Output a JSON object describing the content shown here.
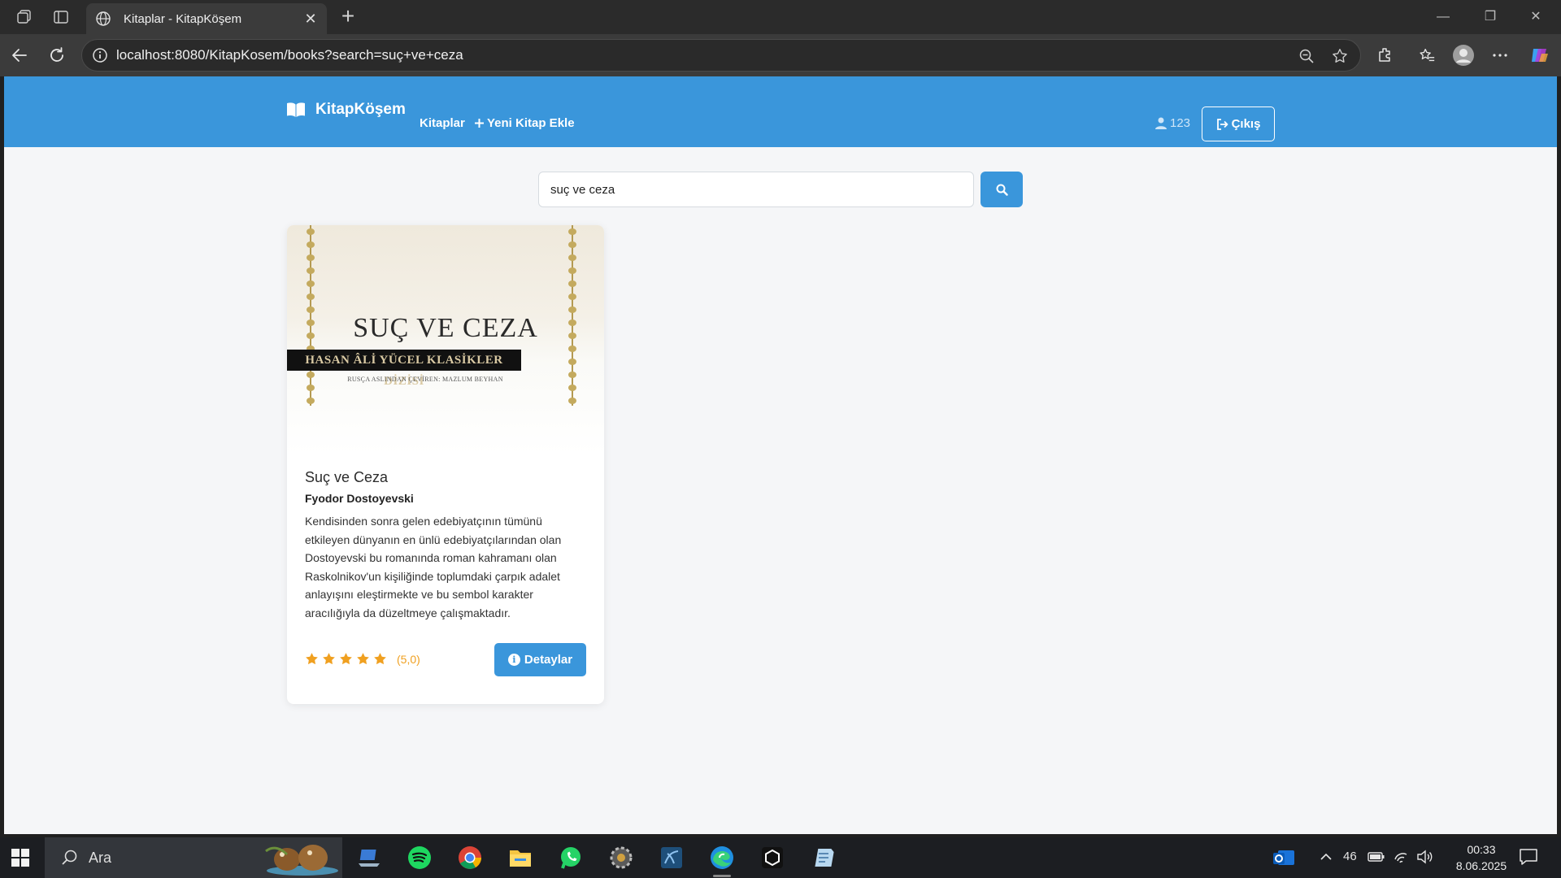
{
  "browser": {
    "tab_title": "Kitaplar - KitapKöşem",
    "url": "localhost:8080/KitapKosem/books?search=suç+ve+ceza",
    "new_tab": "+",
    "close_tab": "✕"
  },
  "navbar": {
    "brand": "KitapKöşem",
    "links": [
      {
        "label": "Kitaplar"
      },
      {
        "label": "Yeni Kitap Ekle"
      }
    ],
    "user": "123",
    "logout": "Çıkış"
  },
  "search": {
    "value": "suç ve ceza"
  },
  "books": [
    {
      "cover": {
        "title": "SUÇ VE CEZA",
        "series": "HASAN ÂLİ YÜCEL KLASİKLER DİZİSİ",
        "translator": "RUSÇA ASLINDAN ÇEVİREN: MAZLUM BEYHAN"
      },
      "title": "Suç ve Ceza",
      "author": "Fyodor Dostoyevski",
      "description": "Kendisinden sonra gelen edebiyatçının tümünü etkileyen dünyanın en ünlü edebiyatçılarından olan Dostoyevski bu romanında roman kahramanı olan Raskolnikov'un kişiliğinde toplumdaki çarpık adalet anlayışını eleştirmekte ve bu sembol karakter aracılığıyla da düzeltmeye çalışmaktadır.",
      "rating": 5,
      "rating_text": "(5,0)",
      "details_label": "Detaylar"
    }
  ],
  "taskbar": {
    "search_label": "Ara",
    "tray_temp": "46",
    "time": "00:33",
    "date": "8.06.2025"
  },
  "colors": {
    "primary": "#3a96db",
    "star": "#f0a020",
    "page_bg": "#f5f6f8"
  }
}
